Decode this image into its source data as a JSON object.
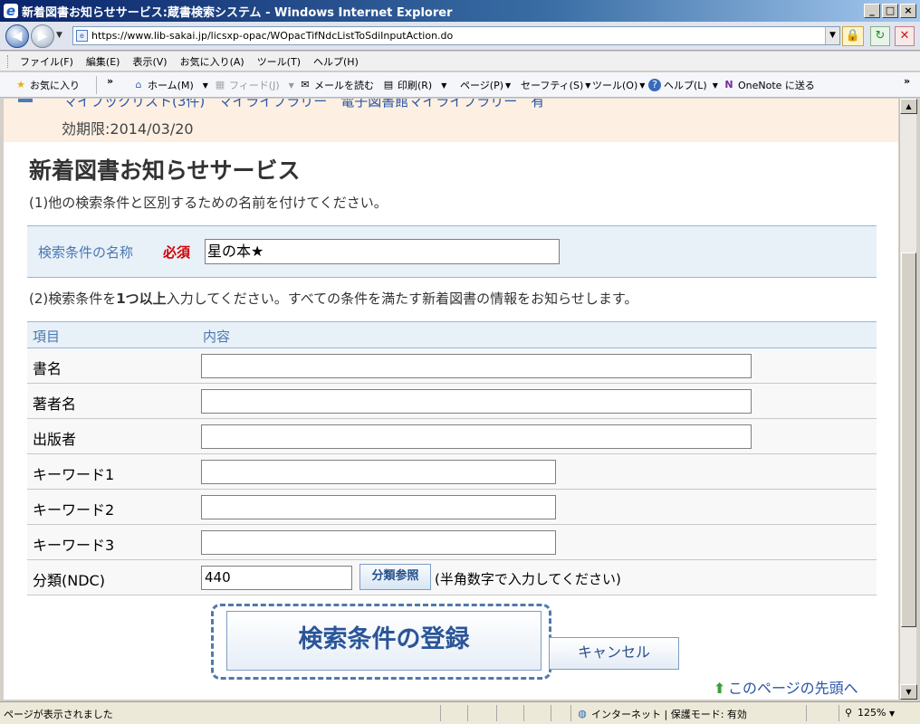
{
  "window": {
    "title": "新着図書お知らせサービス:蔵書検索システム - Windows Internet Explorer",
    "url": "https://www.lib-sakai.jp/licsxp-opac/WOpacTifNdcListToSdiInputAction.do"
  },
  "menu": [
    "ファイル(F)",
    "編集(E)",
    "表示(V)",
    "お気に入り(A)",
    "ツール(T)",
    "ヘルプ(H)"
  ],
  "cmdbar": {
    "favorites": "お気に入り",
    "home": "ホーム(M)",
    "feed": "フィード(J)",
    "mail": "メールを読む",
    "print": "印刷(R)",
    "page": "ページ(P)",
    "safety": "セーフティ(S)",
    "tools": "ツール(O)",
    "help": "ヘルプ(L)",
    "onenote": "OneNote に送る"
  },
  "topband": {
    "links": "マイブックリスト(3件)　マイライブラリー　電子図書館マイライブラリー　有",
    "expiry": "効期限:2014/03/20"
  },
  "page": {
    "title": "新着図書お知らせサービス",
    "instr1": "(1)他の検索条件と区別するための名前を付けてください。",
    "name_label": "検索条件の名称",
    "required": "必須",
    "name_value": "星の本★",
    "instr2_a": "(2)検索条件を",
    "instr2_b": "1つ以上",
    "instr2_c": "入力してください。すべての条件を満たす新着図書の情報をお知らせします。",
    "col_item": "項目",
    "col_content": "内容",
    "rows": [
      {
        "label": "書名",
        "value": ""
      },
      {
        "label": "著者名",
        "value": ""
      },
      {
        "label": "出版者",
        "value": ""
      },
      {
        "label": "キーワード1",
        "value": ""
      },
      {
        "label": "キーワード2",
        "value": ""
      },
      {
        "label": "キーワード3",
        "value": ""
      }
    ],
    "ndc_label": "分類(NDC)",
    "ndc_value": "440",
    "ndc_button": "分類参照",
    "ndc_hint": "(半角数字で入力してください)",
    "register_button": "検索条件の登録",
    "cancel_button": "キャンセル",
    "page_top": "このページの先頭へ"
  },
  "status": {
    "text": "ページが表示されました",
    "zone": "インターネット | 保護モード: 有効",
    "zoom": "125%"
  }
}
